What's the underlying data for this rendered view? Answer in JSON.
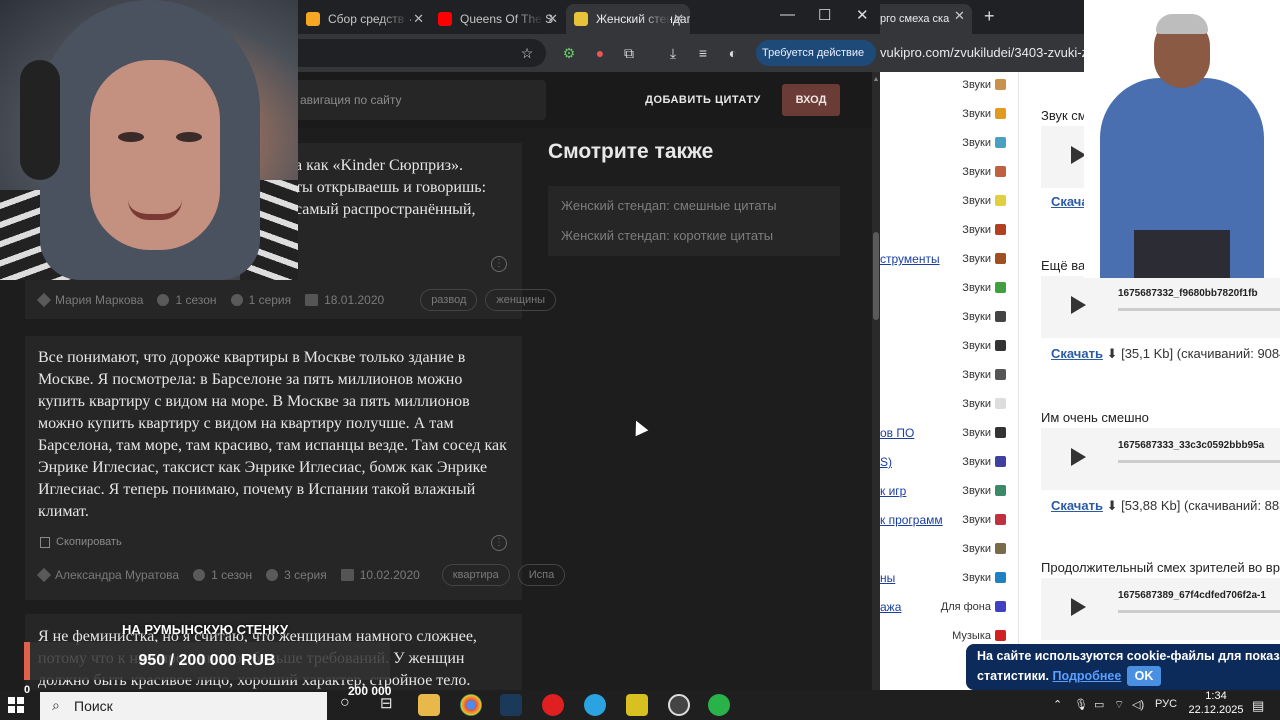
{
  "browser": {
    "tabs": [
      {
        "label": "Сбор средств - ",
        "color": "#f5a623"
      },
      {
        "label": "Queens Of The S",
        "color": "#ff0000"
      },
      {
        "label": "Женский стендап",
        "color": "#e8c33a"
      }
    ],
    "action_label": "Требуется действие",
    "window_controls": [
      "—",
      "☐",
      "✕"
    ]
  },
  "site": {
    "nav_placeholder": "авигация по сайту",
    "add_quote": "ДОБАВИТЬ ЦИТАТУ",
    "login": "ВХОД"
  },
  "quotes": [
    {
      "lines": [
        "а как «Kinder Сюрприз».",
        "ты открываешь и говоришь:",
        "самый распространённый,"
      ],
      "author": "Мария Маркова",
      "season": "1 сезон",
      "episode": "1 серия",
      "date": "18.01.2020",
      "tags": [
        "развод",
        "женщины"
      ]
    },
    {
      "text": "Все понимают, что дороже квартиры в Москве только здание в Москве. Я посмотрела: в Барселоне за пять миллионов можно купить квартиру с видом на море. В Москве за пять миллионов можно купить квартиру с видом на квартиру получше. А там Барселона, там море, там красиво, там испанцы везде. Там сосед как Энрике Иглесиас, таксист как Энрике Иглесиас, бомж как Энрике Иглесиас. Я теперь понимаю, почему в Испании такой влажный климат.",
      "copy": "Скопировать",
      "author": "Александра Муратова",
      "season": "1 сезон",
      "episode": "3 серия",
      "date": "10.02.2020",
      "tags": [
        "квартира",
        "Испа"
      ]
    },
    {
      "lines": [
        "Я не феминистка, но я считаю, что женщинам намного сложнее,",
        "потому что к нам предъявляют больше требований. У женщин",
        "должно быть красивое лицо, хороший характер, стройное тело."
      ]
    }
  ],
  "see_also": {
    "title": "Смотрите также",
    "links": [
      "Женский стендап: смешные цитаты",
      "Женский стендап: короткие цитаты"
    ]
  },
  "donation": {
    "title": "НА РУМЫНСКУЮ СТЕНКУ",
    "amount": "950 / 200 000 RUB",
    "goal": "200 000",
    "start": "0",
    "progress": 0.00475
  },
  "right_browser": {
    "tab": "рго смеха ска",
    "url": "vukipro.com/zvukiludei/3403-zvuki-zak"
  },
  "sidebar_rows": [
    {
      "left": "",
      "label": "Звуки",
      "icon": "#c9924c"
    },
    {
      "left": "",
      "label": "Звуки",
      "icon": "#e09a20"
    },
    {
      "left": "",
      "label": "Звуки",
      "icon": "#4aa0c0"
    },
    {
      "left": "",
      "label": "Звуки",
      "icon": "#c06040"
    },
    {
      "left": "",
      "label": "Звуки",
      "icon": "#e0d040"
    },
    {
      "left": "",
      "label": "Звуки",
      "icon": "#b04020"
    },
    {
      "left": "струменты",
      "label": "Звуки",
      "icon": "#a05020"
    },
    {
      "left": "",
      "label": "Звуки",
      "icon": "#40a040"
    },
    {
      "left": "",
      "label": "Звуки",
      "icon": "#444444"
    },
    {
      "left": "",
      "label": "Звуки",
      "icon": "#333333"
    },
    {
      "left": "",
      "label": "Звуки",
      "icon": "#555555"
    },
    {
      "left": "",
      "label": "Звуки",
      "icon": "#dddddd"
    },
    {
      "left": "ов ПО",
      "label": "Звуки",
      "icon": "#333333"
    },
    {
      "left": "S)",
      "label": "Звуки",
      "icon": "#4040a0"
    },
    {
      "left": "к игр",
      "label": "Звуки",
      "icon": "#3a8a6a"
    },
    {
      "left": "к программ",
      "label": "Звуки",
      "icon": "#c03040"
    },
    {
      "left": "",
      "label": "Звуки",
      "icon": "#7a6a4a"
    },
    {
      "left": "ны",
      "label": "Звуки",
      "icon": "#2080c0"
    },
    {
      "left": "ажа",
      "label": "Для фона",
      "icon": "#4040c0"
    },
    {
      "left": "",
      "label": "Музыка",
      "icon": "#d02020"
    }
  ],
  "sounds": [
    {
      "title": "Звук см",
      "file": "",
      "download": "Скача",
      "info": ""
    },
    {
      "title": "Ещё ва",
      "file": "1675687332_f9680bb7820f1fb",
      "download": "Скачать",
      "info": "[35,1 Kb] (скачиваний: 9084"
    },
    {
      "title": "Им очень смешно",
      "file": "1675687333_33c3c0592bbb95a",
      "download": "Скачать",
      "info": "[53,88 Kb] (скачиваний: 883"
    },
    {
      "title": "Продолжительный смех зрителей во врем",
      "file": "1675687389_67f4cdfed706f2a-1",
      "download": "",
      "info": ""
    }
  ],
  "cookie": {
    "line1": "На сайте используются cookie-файлы для показа рекла",
    "line2": "статистики. ",
    "more": "Подробнее",
    "ok": "OK"
  },
  "taskbar": {
    "search": "Поиск",
    "lang": "РУС",
    "time": "1:34",
    "date": "22.12.2025"
  }
}
